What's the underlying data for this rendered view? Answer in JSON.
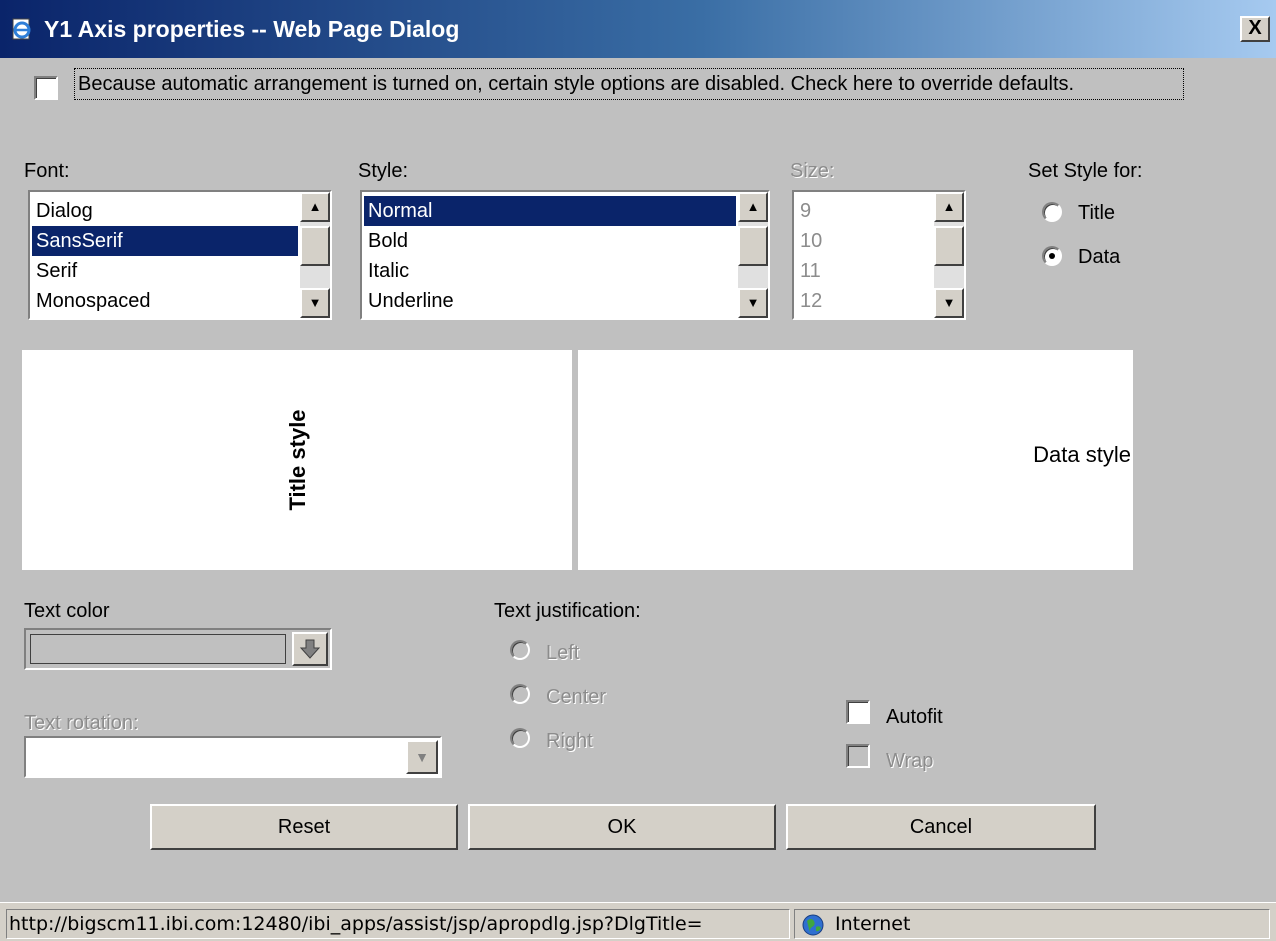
{
  "window": {
    "title": "Y1 Axis properties -- Web Page Dialog",
    "close_label": "X"
  },
  "override": {
    "checked": false,
    "label": "Because automatic arrangement is turned on, certain style options are disabled. Check here to override defaults."
  },
  "font": {
    "label": "Font:",
    "items": [
      "Dialog",
      "SansSerif",
      "Serif",
      "Monospaced"
    ],
    "selected": "SansSerif"
  },
  "style": {
    "label": "Style:",
    "items": [
      "Normal",
      "Bold",
      "Italic",
      "Underline"
    ],
    "selected": "Normal"
  },
  "size": {
    "label": "Size:",
    "items": [
      "9",
      "10",
      "11",
      "12"
    ],
    "enabled": false
  },
  "set_style_for": {
    "label": "Set Style for:",
    "options": [
      "Title",
      "Data"
    ],
    "selected": "Data"
  },
  "preview": {
    "title_text": "Title style",
    "data_text": "Data style"
  },
  "text_color": {
    "label": "Text color",
    "value": ""
  },
  "text_rotation": {
    "label": "Text rotation:",
    "value": "",
    "enabled": false
  },
  "text_justification": {
    "label": "Text justification:",
    "options": [
      "Left",
      "Center",
      "Right"
    ],
    "enabled": false
  },
  "autofit": {
    "label": "Autofit",
    "checked": false
  },
  "wrap": {
    "label": "Wrap",
    "checked": false,
    "enabled": false
  },
  "buttons": {
    "reset": "Reset",
    "ok": "OK",
    "cancel": "Cancel"
  },
  "status": {
    "url": "http://bigscm11.ibi.com:12480/ibi_apps/assist/jsp/apropdlg.jsp?DlgTitle=",
    "zone": "Internet"
  },
  "colors": {
    "selection": "#0a246a",
    "dialog_bg": "#c0c0c0",
    "title_gradient_start": "#0a246a"
  }
}
